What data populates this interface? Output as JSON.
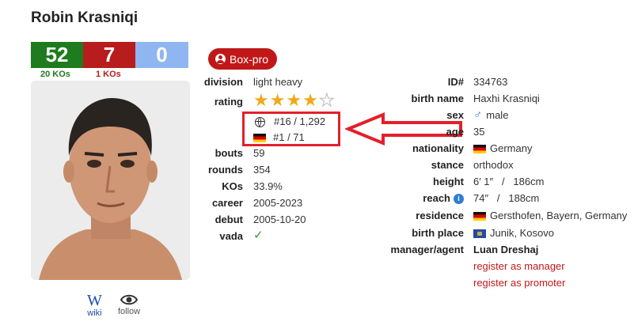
{
  "boxer": {
    "name": "Robin Krasniqi"
  },
  "record": {
    "wins": "52",
    "losses": "7",
    "draws": "0",
    "wins_kos": "20 KOs",
    "losses_kos": "1 KOs",
    "colors": {
      "win": "#1e7b1e",
      "loss": "#b81c1c",
      "draw": "#8fb6f0"
    }
  },
  "badge": {
    "label": "Box-pro",
    "color": "#c01818"
  },
  "links": {
    "wiki_glyph": "W",
    "wiki_label": "wiki",
    "follow_label": "follow"
  },
  "left_table": {
    "division_label": "division",
    "division_value": "light heavy",
    "rating_label": "rating",
    "rating_stars": 4,
    "rating_max": 5,
    "rank_world": "#16 / 1,292",
    "rank_country": "#1 / 71",
    "bouts_label": "bouts",
    "bouts_value": "59",
    "rounds_label": "rounds",
    "rounds_value": "354",
    "kos_label": "KOs",
    "kos_value": "33.9%",
    "career_label": "career",
    "career_value": "2005-2023",
    "debut_label": "debut",
    "debut_value": "2005-10-20",
    "vada_label": "vada",
    "vada_value": "✓"
  },
  "right_table": {
    "id_label": "ID#",
    "id_value": "334763",
    "birthname_label": "birth name",
    "birthname_value": "Haxhi Krasniqi",
    "sex_label": "sex",
    "sex_value": "male",
    "age_label": "age",
    "age_value": "35",
    "nationality_label": "nationality",
    "nationality_value": "Germany",
    "stance_label": "stance",
    "stance_value": "orthodox",
    "height_label": "height",
    "height_value": "6′ 1″   /   186cm",
    "reach_label": "reach",
    "reach_value": "74″   /   188cm",
    "residence_label": "residence",
    "residence_value": "Gersthofen, Bayern, Germany",
    "birthplace_label": "birth place",
    "birthplace_value": "Junik, Kosovo",
    "manager_label": "manager/agent",
    "manager_value": "Luan Dreshaj",
    "register_manager": "register as manager",
    "register_promoter": "register as promoter"
  },
  "annotation": {
    "color": "#e3202b"
  }
}
